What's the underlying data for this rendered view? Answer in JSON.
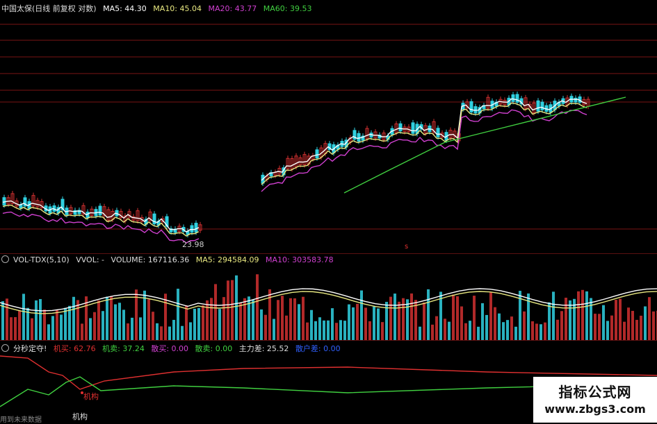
{
  "colors": {
    "up": "#d03030",
    "down": "#30d0e0",
    "ma5": "#ffffff",
    "ma10": "#e8e880",
    "ma20": "#d040d0",
    "ma60": "#40d040",
    "grid": "#7a1515",
    "green": "#40d040",
    "red": "#e03030",
    "blue": "#3060ff"
  },
  "price_header": {
    "title": "中国太保(日线 前复权 对数)",
    "ma5": "MA5: 44.30",
    "ma10": "MA10: 45.04",
    "ma20": "MA20: 43.77",
    "ma60": "MA60: 39.53"
  },
  "price_low_label": "23.98",
  "price_marker": "s",
  "volume_header": {
    "name": "VOL-TDX(5,10)",
    "vvol": "VVOL: -",
    "volume": "VOLUME: 167116.36",
    "ma5": "MA5: 294584.09",
    "ma10": "MA10: 303583.78"
  },
  "indicator_header": {
    "name": "分秒定夺!",
    "jimai": "机买: 62.76",
    "jimai2": "机卖: 37.24",
    "sanmai": "散买: 0.00",
    "sanmai2": "散卖: 0.00",
    "zhuli": "主力差: 25.52",
    "zhuhu": "散户差: 0.00"
  },
  "indicator_labels": {
    "marker": "机构",
    "bottom_left": "用到未来数据",
    "bottom_mid": "机构"
  },
  "watermark": {
    "line1": "指标公式网",
    "line2": "www.zbgs3.com"
  },
  "icons": {
    "panel_toggle": "circle-icon"
  }
}
